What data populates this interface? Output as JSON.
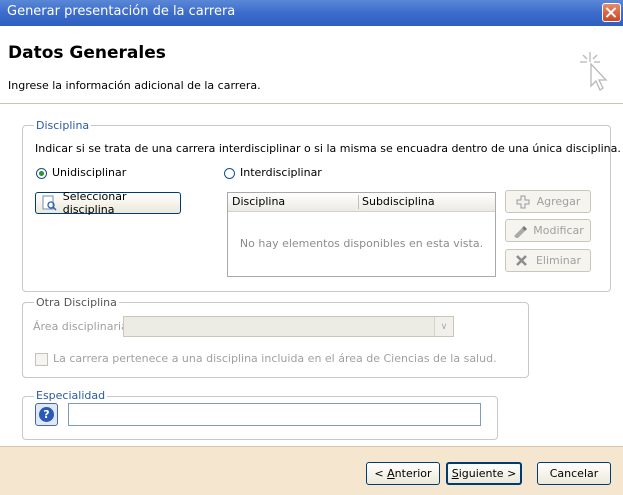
{
  "window": {
    "title": "Generar presentación de la carrera"
  },
  "header": {
    "title": "Datos Generales",
    "subtitle": "Ingrese la información adicional de la carrera."
  },
  "disciplina": {
    "legend": "Disciplina",
    "instruction": "Indicar si se trata de una carrera interdisciplinar o si la misma se encuadra dentro de una única disciplina.",
    "radio_uni": "Unidisciplinar",
    "radio_inter": "Interdisciplinar",
    "select_button": "Seleccionar disciplina",
    "grid": {
      "columns": [
        "Disciplina",
        "Subdisciplina"
      ],
      "empty_text": "No hay elementos disponibles en esta vista."
    },
    "add_button": "Agregar",
    "edit_button": "Modificar",
    "delete_button": "Eliminar"
  },
  "otra": {
    "legend": "Otra Disciplina",
    "area_label": "Área disciplinaria",
    "checkbox_label": "La carrera pertenece a una disciplina incluida en el área de Ciencias de la salud."
  },
  "especialidad": {
    "legend": "Especialidad",
    "value": ""
  },
  "footer": {
    "back_prefix": "< ",
    "back_key": "A",
    "back_rest": "nterior",
    "next_key": "S",
    "next_rest": "iguiente >",
    "cancel": "Cancelar"
  }
}
